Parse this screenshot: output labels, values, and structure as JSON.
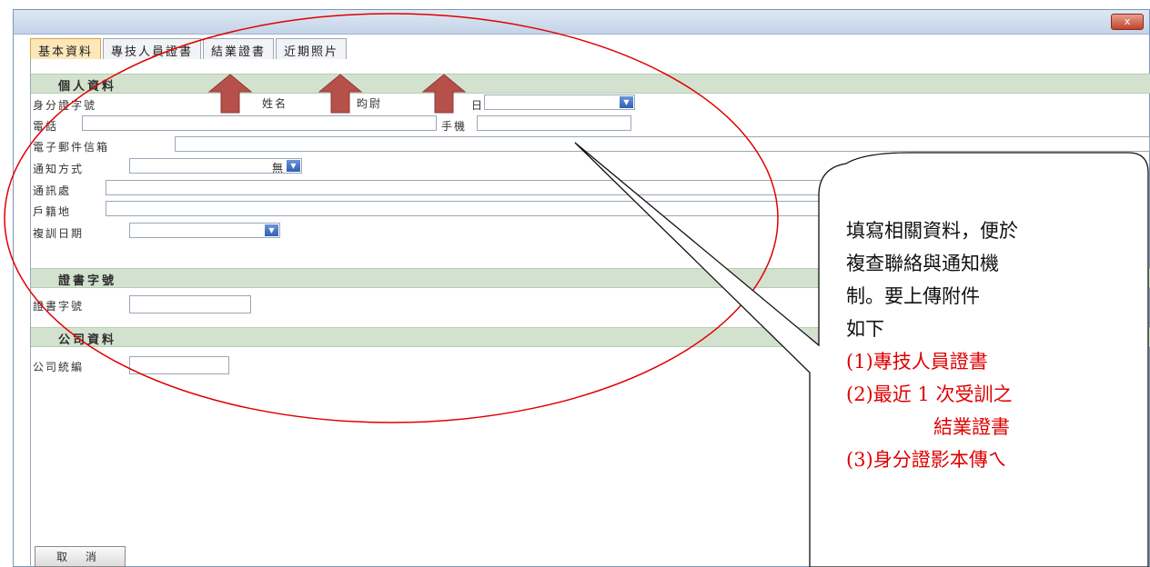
{
  "window": {
    "close_label": "x"
  },
  "tabs": [
    {
      "label": "基本資料",
      "active": true
    },
    {
      "label": "專技人員證書",
      "active": false
    },
    {
      "label": "結業證書",
      "active": false
    },
    {
      "label": "近期照片",
      "active": false
    }
  ],
  "sections": {
    "personal": "個人資料",
    "certificate": "證書字號",
    "company": "公司資料"
  },
  "fields": {
    "id_number_label": "身分證字號",
    "name_label": "姓名",
    "name_value": "昀尉",
    "birth_label": "日",
    "phone_label": "電話",
    "mobile_label": "手機",
    "email_label": "電子郵件信箱",
    "notify_label": "通知方式",
    "notify_value": "無",
    "address_label": "通訊處",
    "household_label": "戶籍地",
    "retrain_label": "複訓日期",
    "cert_number_label": "證書字號",
    "company_id_label": "公司統編"
  },
  "buttons": {
    "cancel": "取 消"
  },
  "callout": {
    "line1": "填寫相關資料，便於",
    "line2": "複查聯絡與通知機",
    "line3": "制。要上傳附件",
    "line4": "如下",
    "item1": "(1)專技人員證書",
    "item2": "(2)最近 1 次受訓之",
    "item2b": "結業證書",
    "item3": "(3)身分證影本傳ㄟ"
  },
  "colors": {
    "annotation_red": "#e00000",
    "arrow_fill": "#b5504a",
    "section_green": "#d3e2ce"
  }
}
